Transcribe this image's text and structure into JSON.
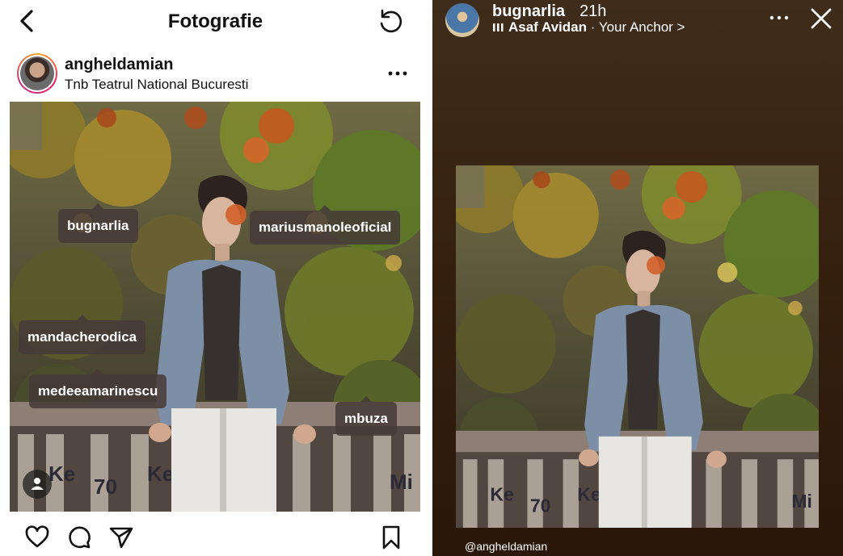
{
  "post_view": {
    "title": "Fotografie",
    "author": {
      "username": "angheldamian",
      "location": "Tnb Teatrul National Bucuresti"
    },
    "photo": {
      "tags": [
        "bugnarlia",
        "mariusmanoleoficial",
        "mandacherodica",
        "medeeamarinescu",
        "mbuza"
      ],
      "graffiti": [
        "Ke",
        "70",
        "Ke",
        "Mi"
      ]
    },
    "icons": {
      "back": "back-arrow-icon",
      "refresh": "refresh-icon",
      "more": "more-options-icon",
      "tagged": "person-tag-icon",
      "like": "heart-icon",
      "comment": "comment-icon",
      "share": "send-icon",
      "save": "bookmark-icon"
    }
  },
  "story_view": {
    "username": "bugnarlia",
    "time": "21h",
    "music": {
      "artist": "Asaf Avidan",
      "song": "· Your Anchor",
      "chevron": ">"
    },
    "mention": "@angheldamian",
    "icons": {
      "more": "more-options-icon",
      "close": "close-icon"
    }
  },
  "colors": {
    "tag_bg": "#463a38",
    "story_bg": "#36210f",
    "text": "#111111"
  }
}
